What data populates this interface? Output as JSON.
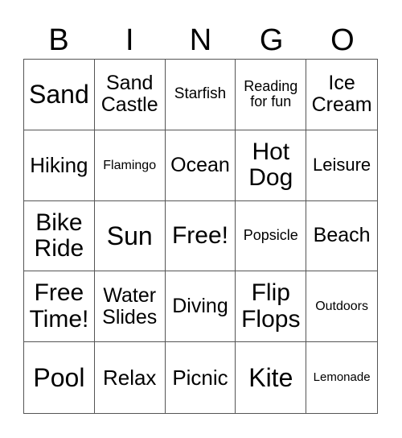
{
  "header": [
    "B",
    "I",
    "N",
    "G",
    "O"
  ],
  "cells": [
    "Sand",
    "Sand Castle",
    "Starfish",
    "Reading for fun",
    "Ice Cream",
    "Hiking",
    "Flamingo",
    "Ocean",
    "Hot Dog",
    "Leisure",
    "Bike Ride",
    "Sun",
    "Free!",
    "Popsicle",
    "Beach",
    "Free Time!",
    "Water Slides",
    "Diving",
    "Flip Flops",
    "Outdoors",
    "Pool",
    "Relax",
    "Picnic",
    "Kite",
    "Lemonade"
  ]
}
